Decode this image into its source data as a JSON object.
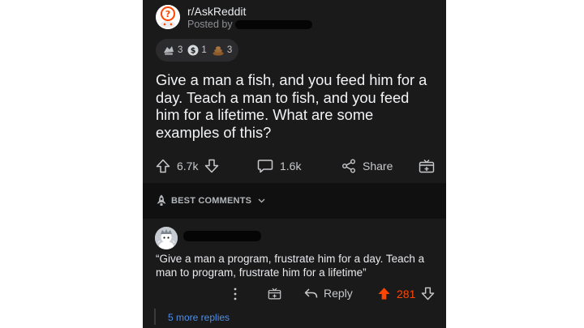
{
  "post": {
    "subreddit": "r/AskReddit",
    "posted_by_label": "Posted by",
    "awards": [
      {
        "icon": "silver-award-icon",
        "count": "3"
      },
      {
        "icon": "gold-coin-icon",
        "count": "1"
      },
      {
        "icon": "poop-award-icon",
        "count": "3"
      }
    ],
    "title": "Give a man a fish, and you feed him for a day. Teach a man to fish, and you feed him for a lifetime. What are some examples of this?",
    "upvotes": "6.7k",
    "comments": "1.6k",
    "share_label": "Share"
  },
  "sort": {
    "label": "BEST COMMENTS"
  },
  "comment": {
    "text": "“Give a man a program, frustrate him for a day. Teach a man to program, frustrate him for a lifetime”",
    "reply_label": "Reply",
    "score": "281",
    "more_replies": "5 more replies"
  },
  "colors": {
    "background": "#1a1a1b",
    "text": "#d7dadc",
    "upvote_active": "#ff4500",
    "link": "#4f8fe8"
  }
}
